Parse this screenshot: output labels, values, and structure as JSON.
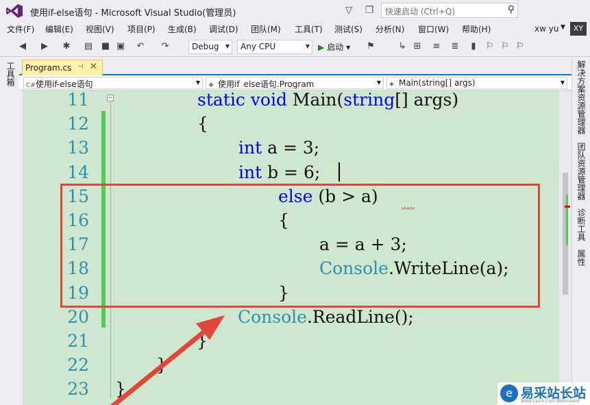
{
  "window": {
    "title": "使用if-else语句 - Microsoft Visual Studio(管理员)",
    "quick_launch_placeholder": "快速启动 (Ctrl+Q)",
    "user_name": "xw yu",
    "user_initials": "XY"
  },
  "menu": [
    "文件(F)",
    "编辑(E)",
    "视图(V)",
    "项目(P)",
    "生成(B)",
    "调试(D)",
    "团队(M)",
    "工具(T)",
    "测试(S)",
    "分析(N)",
    "窗口(W)",
    "帮助(H)"
  ],
  "toolbar": {
    "config": "Debug",
    "platform": "Any CPU",
    "start_label": "启动"
  },
  "left_panel": "工具箱",
  "right_panels": [
    "解决方案资源管理器",
    "团队资源管理器",
    "诊断工具",
    "属性"
  ],
  "tab": {
    "label": "Program.cs",
    "pin": "⊣",
    "close": "✕"
  },
  "navbar": {
    "project": "使用if-else语句",
    "class": "使用if_else语句.Program",
    "member": "Main(string[] args)"
  },
  "editor": {
    "lines": [
      {
        "no": "11",
        "tokens": [
          {
            "t": "static ",
            "c": "kw"
          },
          {
            "t": "void ",
            "c": "kw"
          },
          {
            "t": "Main(",
            "c": ""
          },
          {
            "t": "string",
            "c": "kw"
          },
          {
            "t": "[] args)",
            "c": ""
          }
        ]
      },
      {
        "no": "12",
        "tokens": [
          {
            "t": "{",
            "c": ""
          }
        ]
      },
      {
        "no": "13",
        "tokens": [
          {
            "t": "int ",
            "c": "kw"
          },
          {
            "t": "a = 3;",
            "c": ""
          }
        ]
      },
      {
        "no": "14",
        "tokens": [
          {
            "t": "int ",
            "c": "kw"
          },
          {
            "t": "b = 6;",
            "c": ""
          }
        ]
      },
      {
        "no": "15",
        "tokens": [
          {
            "t": "else ",
            "c": "kw"
          },
          {
            "t": "(b > a)",
            "c": ""
          }
        ]
      },
      {
        "no": "16",
        "tokens": [
          {
            "t": "{",
            "c": ""
          }
        ]
      },
      {
        "no": "17",
        "tokens": [
          {
            "t": "a = a + 3;",
            "c": ""
          }
        ]
      },
      {
        "no": "18",
        "tokens": [
          {
            "t": "Console",
            "c": "cls"
          },
          {
            "t": ".WriteLine(a);",
            "c": ""
          }
        ]
      },
      {
        "no": "19",
        "tokens": [
          {
            "t": "}",
            "c": ""
          }
        ]
      },
      {
        "no": "20",
        "tokens": [
          {
            "t": "Console",
            "c": "cls"
          },
          {
            "t": ".ReadLine();",
            "c": ""
          }
        ]
      },
      {
        "no": "21",
        "tokens": [
          {
            "t": "}",
            "c": ""
          }
        ]
      },
      {
        "no": "22",
        "tokens": [
          {
            "t": "}",
            "c": ""
          }
        ]
      },
      {
        "no": "23",
        "tokens": [
          {
            "t": "}",
            "c": ""
          }
        ]
      }
    ]
  },
  "watermark": {
    "text": "易采站长站",
    "sub": "Www.Easck.Com Webmaster"
  },
  "colors": {
    "accent": "#007acc",
    "editor_bg": "#cfe6cf",
    "keyword": "#0000ff",
    "class": "#2b91af",
    "highlight_box": "#e0463a"
  }
}
